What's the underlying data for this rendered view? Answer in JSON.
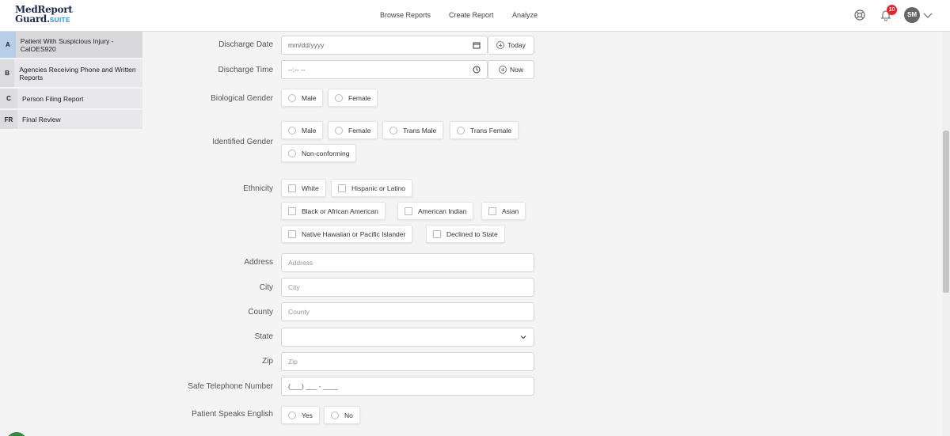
{
  "brand": {
    "line1": "MedReport",
    "line2": "Guard.",
    "suite": "SUITE"
  },
  "nav": {
    "browse": "Browse Reports",
    "create": "Create Report",
    "analyze": "Analyze"
  },
  "header": {
    "notification_count": "10",
    "avatar_initials": "SM",
    "help_icon": "lifebuoy-icon",
    "bell_icon": "bell-icon",
    "menu_icon": "chevron-down-icon"
  },
  "sidebar": {
    "items": [
      {
        "letter": "A",
        "label": "Patient With Suspicious Injury - CalOES920"
      },
      {
        "letter": "B",
        "label": "Agencies Receiving Phone and Written Reports"
      },
      {
        "letter": "C",
        "label": "Person Filing Report"
      },
      {
        "letter": "FR",
        "label": "Final Review"
      }
    ]
  },
  "form": {
    "discharge_date": {
      "label": "Discharge Date",
      "placeholder": "mm/dd/yyyy",
      "button": "Today"
    },
    "discharge_time": {
      "label": "Discharge Time",
      "placeholder": "--:-- --",
      "button": "Now"
    },
    "bio_gender": {
      "label": "Biological Gender",
      "options": [
        "Male",
        "Female"
      ]
    },
    "identified_gender": {
      "label": "Identified Gender",
      "options": [
        "Male",
        "Female",
        "Trans Male",
        "Trans Female",
        "Non-conforming"
      ]
    },
    "ethnicity": {
      "label": "Ethnicity",
      "options": [
        "White",
        "Hispanic or Latino",
        "Black or African American",
        "American Indian",
        "Asian",
        "Native Hawaiian or Pacific Islander",
        "Declined to State"
      ]
    },
    "address": {
      "label": "Address",
      "placeholder": "Address"
    },
    "city": {
      "label": "City",
      "placeholder": "City"
    },
    "county": {
      "label": "County",
      "placeholder": "County"
    },
    "state": {
      "label": "State",
      "value": ""
    },
    "zip": {
      "label": "Zip",
      "placeholder": "Zip"
    },
    "phone": {
      "label": "Safe Telephone Number",
      "placeholder": "(___) ___ - ____"
    },
    "english": {
      "label": "Patient Speaks English",
      "options": [
        "Yes",
        "No"
      ]
    }
  },
  "colors": {
    "accent": "#2b8fd6",
    "brand_navy": "#1d2b4f",
    "badge": "#e02828",
    "active_tab": "#b7cde8"
  }
}
